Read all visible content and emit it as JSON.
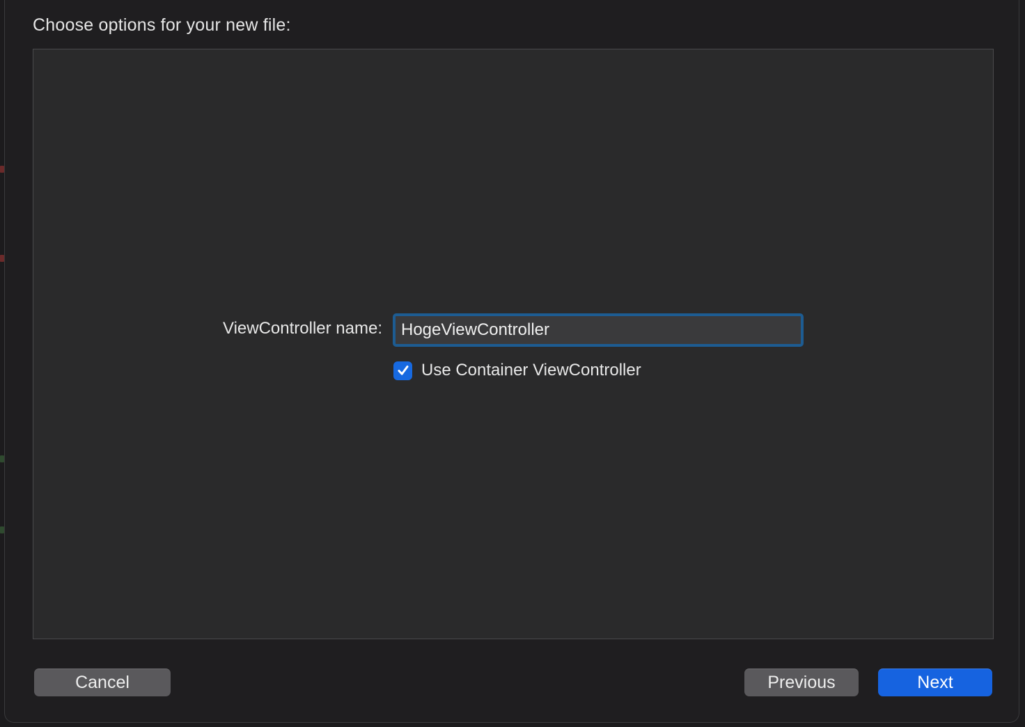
{
  "dialog": {
    "title": "Choose options for your new file:"
  },
  "options": {
    "name_label": "ViewController name:",
    "name_value": "HogeViewController",
    "container_checkbox": {
      "label": "Use Container ViewController",
      "checked": true
    }
  },
  "buttons": {
    "cancel": "Cancel",
    "previous": "Previous",
    "next": "Next"
  },
  "colors": {
    "accent": "#1663e0",
    "focus_ring": "#1d5c92",
    "panel_background": "#2a2a2b",
    "sheet_background": "#1f1e20"
  }
}
